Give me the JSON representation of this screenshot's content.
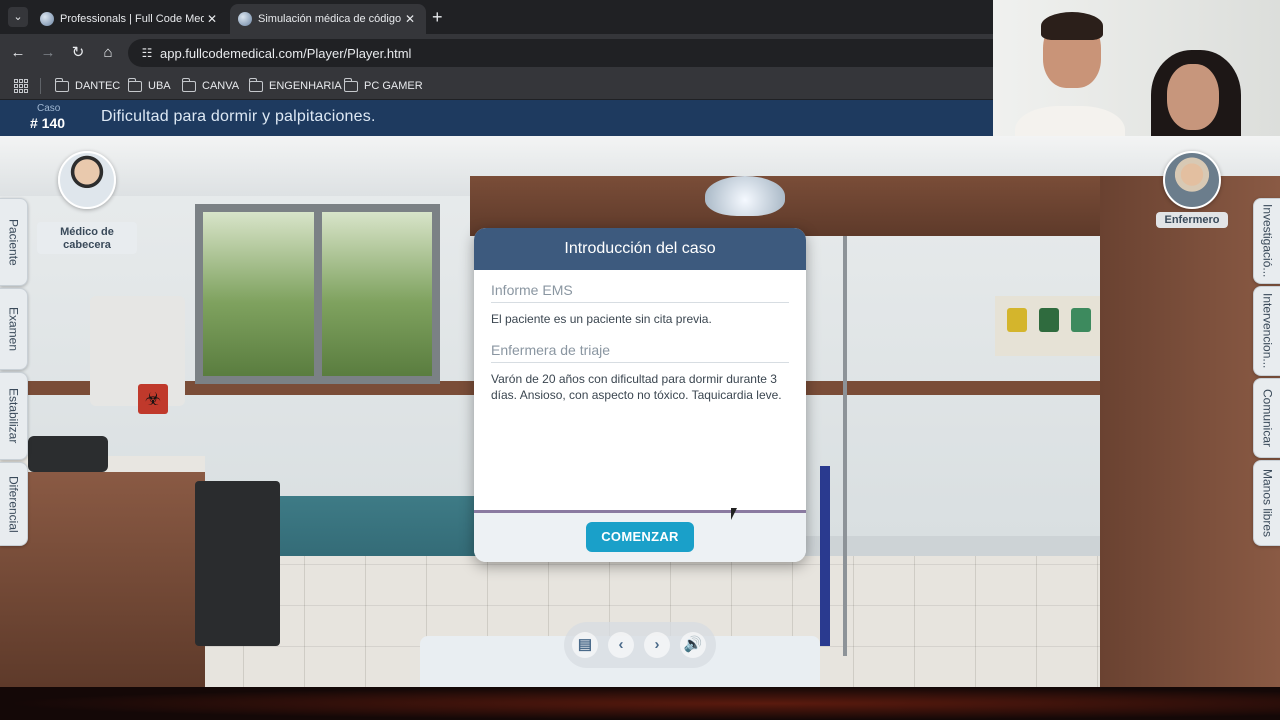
{
  "browser": {
    "tabs": [
      {
        "title": "Professionals | Full Code Medic",
        "active": false
      },
      {
        "title": "Simulación médica de código c",
        "active": true
      }
    ],
    "url": "app.fullcodemedical.com/Player/Player.html",
    "bookmarks": [
      "DANTEC",
      "UBA",
      "CANVA",
      "ENGENHARIA",
      "PC GAMER"
    ]
  },
  "case": {
    "label": "Caso",
    "number": "# 140",
    "title": "Dificultad para dormir y palpitaciones."
  },
  "left_tabs": [
    "Paciente",
    "Examen",
    "Estabilizar",
    "Diferencial"
  ],
  "right_tabs": [
    "Investigació...",
    "Intervencion...",
    "Comunicar",
    "Manos libres"
  ],
  "characters": {
    "doctor_label": "Médico de cabecera",
    "nurse_label": "Enfermero"
  },
  "modal": {
    "title": "Introducción del caso",
    "sections": [
      {
        "heading": "Informe EMS",
        "text": "El paciente es un paciente sin cita previa."
      },
      {
        "heading": "Enfermera de triaje",
        "text": "Varón de 20 años con dificultad para dormir durante 3 días. Ansioso, con aspecto no tóxico. Taquicardia leve."
      }
    ],
    "button": "COMENZAR"
  },
  "colors": {
    "header_bg": "#1e3a5f",
    "modal_header": "#3d5a7e",
    "button": "#1aa0c9"
  }
}
